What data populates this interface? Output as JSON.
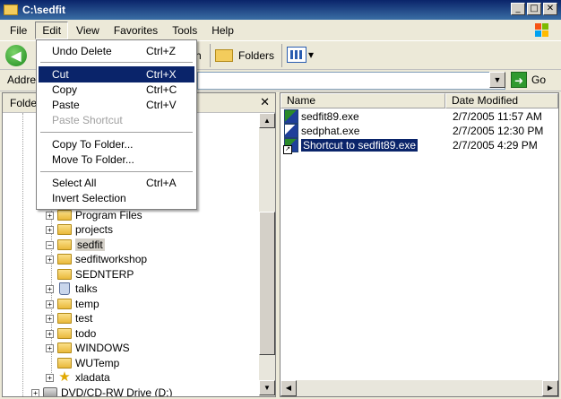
{
  "window": {
    "title": "C:\\sedfit",
    "min": "_",
    "max": "□",
    "close": "✕"
  },
  "menubar": [
    "File",
    "Edit",
    "View",
    "Favorites",
    "Tools",
    "Help"
  ],
  "toolbar": {
    "back_arrow": "◀",
    "search_tail": "h",
    "folders_label": "Folders",
    "views_arrow": "▾"
  },
  "address": {
    "label": "Address",
    "value": "",
    "drop_arrow": "▼",
    "go_label": "Go",
    "go_arrow": "➜"
  },
  "folders_pane": {
    "title": "Folders",
    "close": "✕",
    "tree": [
      {
        "label": "Program Files",
        "expander": "+",
        "icon": "folder-icon"
      },
      {
        "label": "projects",
        "expander": "+",
        "icon": "folder-icon"
      },
      {
        "label": "sedfit",
        "expander": "−",
        "icon": "folder-icon",
        "selected": true
      },
      {
        "label": "sedfitworkshop",
        "expander": "+",
        "icon": "folder-icon"
      },
      {
        "label": "SEDNTERP",
        "expander": "",
        "icon": "folder-icon"
      },
      {
        "label": "talks",
        "expander": "+",
        "icon": "recycle-bin-icon"
      },
      {
        "label": "temp",
        "expander": "+",
        "icon": "folder-icon"
      },
      {
        "label": "test",
        "expander": "+",
        "icon": "folder-icon"
      },
      {
        "label": "todo",
        "expander": "+",
        "icon": "folder-icon"
      },
      {
        "label": "WINDOWS",
        "expander": "+",
        "icon": "folder-icon"
      },
      {
        "label": "WUTemp",
        "expander": "",
        "icon": "folder-icon"
      },
      {
        "label": "xladata",
        "expander": "+",
        "icon": "star-icon"
      },
      {
        "label": "DVD/CD-RW Drive (D:)",
        "expander": "+",
        "icon": "drive-icon"
      }
    ]
  },
  "files_pane": {
    "columns": [
      "Name",
      "Date Modified"
    ],
    "files": [
      {
        "name": "sedfit89.exe",
        "date": "2/7/2005 11:57 AM",
        "selected": false
      },
      {
        "name": "sedphat.exe",
        "date": "2/7/2005 12:30 PM",
        "selected": false
      },
      {
        "name": "Shortcut to sedfit89.exe",
        "date": "2/7/2005 4:29 PM",
        "selected": true
      }
    ]
  },
  "edit_menu": {
    "items": [
      {
        "label": "Undo Delete",
        "shortcut": "Ctrl+Z"
      },
      {
        "label": "Cut",
        "shortcut": "Ctrl+X",
        "highlighted": true
      },
      {
        "label": "Copy",
        "shortcut": "Ctrl+C"
      },
      {
        "label": "Paste",
        "shortcut": "Ctrl+V"
      },
      {
        "label": "Paste Shortcut",
        "shortcut": "",
        "disabled": true
      },
      {
        "label": "Copy To Folder...",
        "shortcut": ""
      },
      {
        "label": "Move To Folder...",
        "shortcut": ""
      },
      {
        "label": "Select All",
        "shortcut": "Ctrl+A"
      },
      {
        "label": "Invert Selection",
        "shortcut": ""
      }
    ]
  },
  "scroll": {
    "up": "▲",
    "down": "▼",
    "left": "◀",
    "right": "▶"
  },
  "colors": {
    "titlebar": "#0a246a",
    "selection": "#0a246a",
    "menu_highlight": "#0a246a"
  }
}
